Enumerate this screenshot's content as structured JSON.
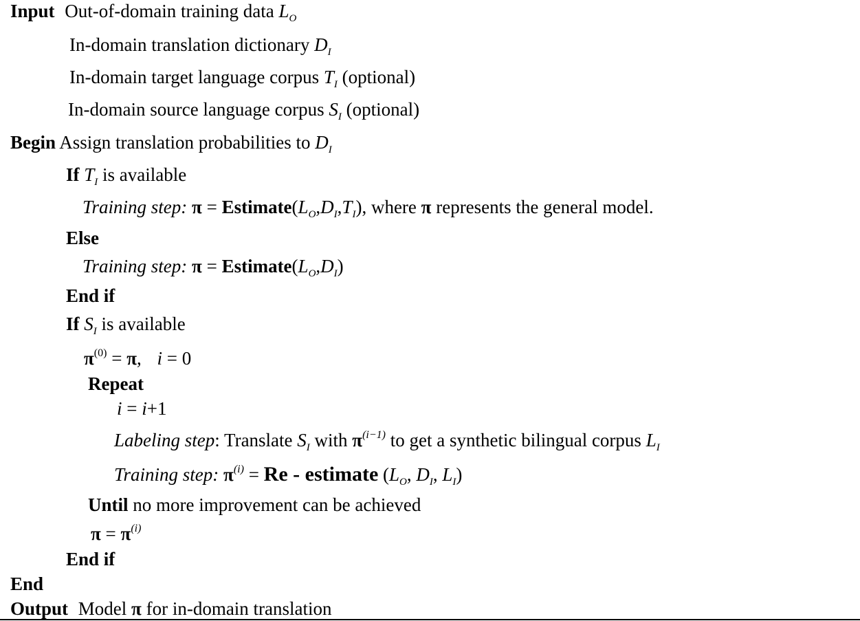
{
  "input": {
    "keyword": "Input",
    "items": [
      {
        "text": "Out-of-domain training data",
        "symbol": "L",
        "sub": "O",
        "note": ""
      },
      {
        "text": "In-domain translation dictionary",
        "symbol": "D",
        "sub": "I",
        "note": ""
      },
      {
        "text": "In-domain target language corpus",
        "symbol": "T",
        "sub": "I",
        "note": "(optional)"
      },
      {
        "text": "In-domain source language corpus",
        "symbol": "S",
        "sub": "I",
        "note": "(optional)"
      }
    ]
  },
  "begin": {
    "keyword": "Begin",
    "text": "Assign translation probabilities to",
    "symbol": "D",
    "sub": "I"
  },
  "if1": {
    "keyword": "If",
    "symbol": "T",
    "sub": "I",
    "text": "is available"
  },
  "training1": {
    "label": "Training step:",
    "pi": "π",
    "eq": "=",
    "fn": "Estimate",
    "args": [
      "L",
      "O",
      "D",
      "I",
      "T",
      "I"
    ],
    "tail": ", where",
    "tail2": "represents the general model."
  },
  "else": {
    "keyword": "Else"
  },
  "training2": {
    "label": "Training step:",
    "fn": "Estimate"
  },
  "endif1": {
    "keyword": "End if"
  },
  "if2": {
    "keyword": "If",
    "symbol": "S",
    "sub": "I",
    "text": "is available"
  },
  "init": {
    "sup": "(0)",
    "i": "i",
    "zero": "0"
  },
  "repeat": {
    "keyword": "Repeat"
  },
  "incr": {
    "lhs": "i",
    "rhs": "i",
    "plus": "+",
    "one": "1"
  },
  "labeling": {
    "label": "Labeling step",
    "colon": ":",
    "text1": "Translate",
    "symbol": "S",
    "sub": "I",
    "with": "with",
    "sup": "(i−1)",
    "text2": "to get a synthetic bilingual corpus",
    "symbol2": "L",
    "sub2": "I"
  },
  "training3": {
    "label": "Training step:",
    "sup": "(i)",
    "fn": "Re - estimate"
  },
  "until": {
    "keyword": "Until",
    "text": "no more improvement can be achieved"
  },
  "assign": {
    "sup": "(i)"
  },
  "endif2": {
    "keyword": "End if"
  },
  "end": {
    "keyword": "End"
  },
  "output": {
    "keyword": "Output",
    "text1": "Model",
    "text2": "for in-domain translation"
  }
}
